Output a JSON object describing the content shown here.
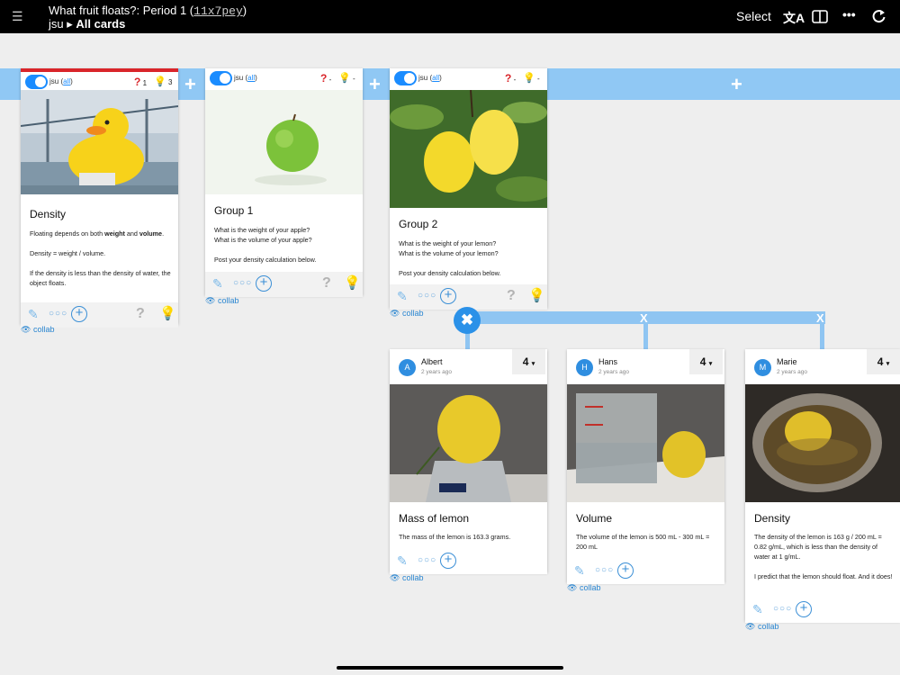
{
  "header": {
    "menu_icon": "hamburger-icon",
    "title": "What fruit floats?: Period 1",
    "code": "11x7pey",
    "breadcrumb_user": "jsu",
    "breadcrumb_sep": "▸",
    "breadcrumb_view": "All cards",
    "select_label": "Select",
    "translate_icon": "translate-icon",
    "split_icon": "split-view-icon",
    "more_icon": "more-icon",
    "refresh_icon": "refresh-icon"
  },
  "strip": {
    "plus": "+"
  },
  "prompts": [
    {
      "owner": "jsu",
      "all": "all",
      "q": "1",
      "bulb": "3",
      "title": "Density",
      "lines": [
        "Floating depends on both weight and volume.",
        "",
        "Density = weight / volume.",
        "",
        "If the density is less than the density of water, the object floats."
      ],
      "collab": "collab"
    },
    {
      "owner": "jsu",
      "all": "all",
      "q": "-",
      "bulb": "-",
      "title": "Group 1",
      "lines": [
        "What is the weight of your apple?",
        "What is the volume of your apple?",
        "",
        "Post your density calculation below."
      ],
      "collab": "collab"
    },
    {
      "owner": "jsu",
      "all": "all",
      "q": "-",
      "bulb": "-",
      "title": "Group 2",
      "lines": [
        "What is the weight of your lemon?",
        "What is the volume of your lemon?",
        "",
        "Post your density calculation below."
      ],
      "collab": "collab"
    }
  ],
  "connector": {
    "x": "X",
    "close": "✖"
  },
  "responses": [
    {
      "initial": "A",
      "name": "Albert",
      "ago": "2 years ago",
      "votes": "4",
      "title": "Mass of lemon",
      "lines": [
        "The mass of the lemon is 163.3 grams."
      ],
      "collab": "collab"
    },
    {
      "initial": "H",
      "name": "Hans",
      "ago": "2 years ago",
      "votes": "4",
      "title": "Volume",
      "lines": [
        "The volume of the lemon is 500 mL - 300 mL = 200 mL"
      ],
      "collab": "collab"
    },
    {
      "initial": "M",
      "name": "Marie",
      "ago": "2 years ago",
      "votes": "4",
      "title": "Density",
      "lines": [
        "The density of the lemon is 163 g / 200 mL = 0.82 g/mL, which is less than the density of water at 1 g/mL.",
        "",
        "I predict that the lemon should float. And it does!"
      ],
      "collab": "collab"
    }
  ],
  "colors": {
    "accent": "#2b91e8",
    "strip": "#90c8f4",
    "question": "#d9252a",
    "bulb": "#3cb83c"
  }
}
